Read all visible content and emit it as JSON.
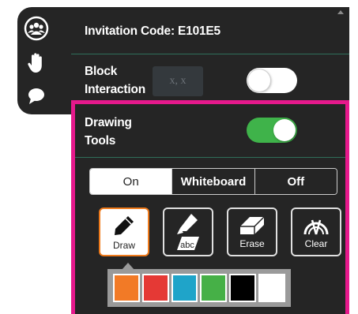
{
  "header": {
    "invitation_code": "Invitation Code: E101E5"
  },
  "rail": {
    "icons": [
      "participants-icon",
      "raise-hand-icon",
      "chat-icon"
    ]
  },
  "block_interaction": {
    "label_line1": "Block",
    "label_line2": "Interaction",
    "behind_text": "x, x",
    "enabled": false
  },
  "drawing_tools": {
    "label_line1": "Drawing",
    "label_line2": "Tools",
    "enabled": true
  },
  "mode": {
    "options": [
      "On",
      "Whiteboard",
      "Off"
    ],
    "selected": "On"
  },
  "tools": [
    {
      "label": "Draw",
      "icon": "pen-icon",
      "active": true
    },
    {
      "label": "abc",
      "icon": "highlighter-icon",
      "active": false
    },
    {
      "label": "Erase",
      "icon": "eraser-icon",
      "active": false
    },
    {
      "label": "Clear",
      "icon": "clear-gauge-icon",
      "active": false
    }
  ],
  "palette": [
    "#f27a26",
    "#e53935",
    "#1fa4c9",
    "#46b047",
    "#000000",
    "#ffffff"
  ],
  "colors": {
    "panel_bg": "#252525",
    "highlight_border": "#e6198c",
    "toggle_on": "#3fb34a",
    "toggle_off": "#ffffff",
    "active_tool_border": "#f07b1c"
  }
}
